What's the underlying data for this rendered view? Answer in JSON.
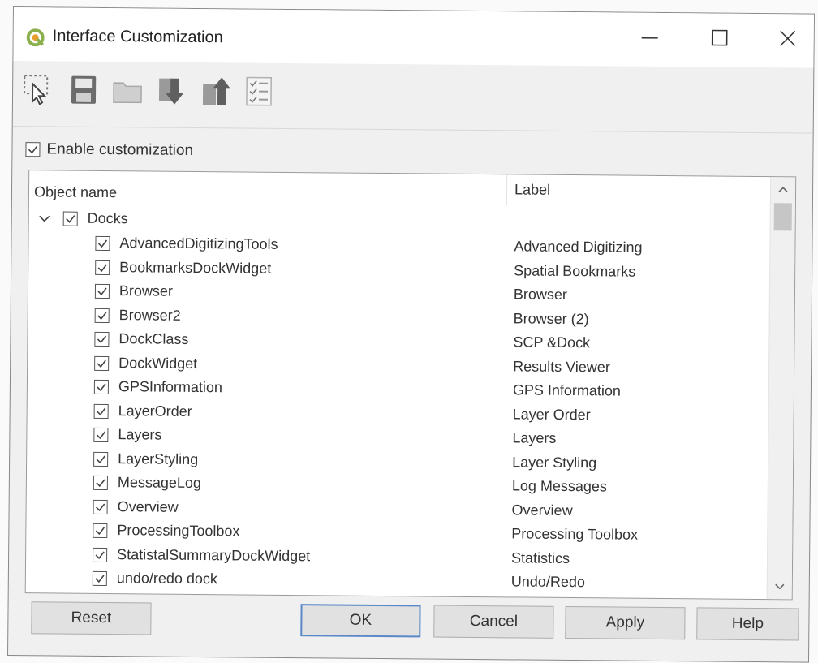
{
  "window": {
    "title": "Interface Customization",
    "accent_color": "#5a88c8",
    "icons": [
      "qgis-logo-icon",
      "minimize-icon",
      "maximize-icon",
      "close-icon"
    ]
  },
  "toolbar": {
    "items": [
      {
        "icon": "select-cursor-icon"
      },
      {
        "icon": "save-icon"
      },
      {
        "icon": "open-folder-icon"
      },
      {
        "icon": "load-from-file-icon"
      },
      {
        "icon": "save-to-file-icon"
      },
      {
        "icon": "expand-all-icon"
      }
    ]
  },
  "enable_customization": {
    "label": "Enable customization",
    "checked": true
  },
  "tree": {
    "columns": {
      "name": "Object name",
      "label": "Label"
    },
    "group": {
      "name": "Docks",
      "checked": true,
      "expanded": true
    },
    "items": [
      {
        "name": "AdvancedDigitizingTools",
        "label": "Advanced Digitizing",
        "checked": true
      },
      {
        "name": "BookmarksDockWidget",
        "label": "Spatial Bookmarks",
        "checked": true
      },
      {
        "name": "Browser",
        "label": "Browser",
        "checked": true
      },
      {
        "name": "Browser2",
        "label": "Browser (2)",
        "checked": true
      },
      {
        "name": "DockClass",
        "label": "SCP &Dock",
        "checked": true
      },
      {
        "name": "DockWidget",
        "label": "Results Viewer",
        "checked": true
      },
      {
        "name": "GPSInformation",
        "label": "GPS Information",
        "checked": true
      },
      {
        "name": "LayerOrder",
        "label": "Layer Order",
        "checked": true
      },
      {
        "name": "Layers",
        "label": "Layers",
        "checked": true
      },
      {
        "name": "LayerStyling",
        "label": "Layer Styling",
        "checked": true
      },
      {
        "name": "MessageLog",
        "label": "Log Messages",
        "checked": true
      },
      {
        "name": "Overview",
        "label": "Overview",
        "checked": true
      },
      {
        "name": "ProcessingToolbox",
        "label": "Processing Toolbox",
        "checked": true
      },
      {
        "name": "StatistalSummaryDockWidget",
        "label": "Statistics",
        "checked": true
      },
      {
        "name": "undo/redo dock",
        "label": "Undo/Redo",
        "checked": true
      }
    ]
  },
  "buttons": {
    "reset": "Reset",
    "ok": "OK",
    "cancel": "Cancel",
    "apply": "Apply",
    "help": "Help"
  }
}
